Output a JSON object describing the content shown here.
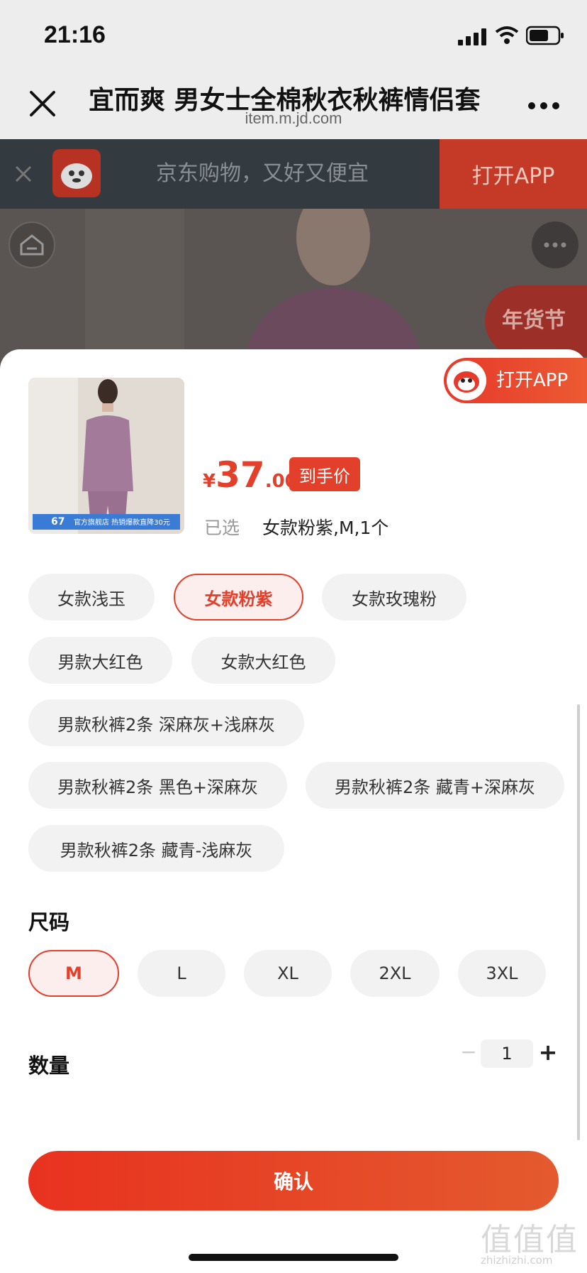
{
  "status_bar": {
    "time": "21:16"
  },
  "browser": {
    "title": "宜而爽 男女士全棉秋衣秋裤情侣套",
    "url": "item.m.jd.com"
  },
  "banner": {
    "text": "京东购物，又好又便宜",
    "open_label": "打开APP"
  },
  "float_open_app": {
    "label": "打开APP"
  },
  "festival_badge": {
    "text": "年货节"
  },
  "product": {
    "thumb_badge_price": "67",
    "thumb_badge_text": "官方旗舰店 热销爆款直降30元",
    "price_currency": "¥",
    "price_int": "37",
    "price_dec": ".00",
    "price_tag": "到手价",
    "selected_label": "已选",
    "selected_value": "女款粉紫,M,1个"
  },
  "colors": {
    "options": [
      "女款浅玉",
      "女款粉紫",
      "女款玫瑰粉",
      "男款大红色",
      "女款大红色",
      "男款秋裤2条 深麻灰+浅麻灰",
      "男款秋裤2条 黑色+深麻灰",
      "男款秋裤2条 藏青+深麻灰",
      "男款秋裤2条 藏青-浅麻灰"
    ],
    "selected": "女款粉紫"
  },
  "size": {
    "title": "尺码",
    "options": [
      "M",
      "L",
      "XL",
      "2XL",
      "3XL"
    ],
    "selected": "M"
  },
  "quantity": {
    "title": "数量",
    "value": "1",
    "minus": "−",
    "plus": "+"
  },
  "confirm_label": "确认",
  "watermark": {
    "text": "值值值",
    "sub": "zhizhizhi.com"
  },
  "theme": {
    "accent": "#e2402b",
    "chip_bg": "#f2f2f2",
    "banner_bg": "#333a40"
  }
}
